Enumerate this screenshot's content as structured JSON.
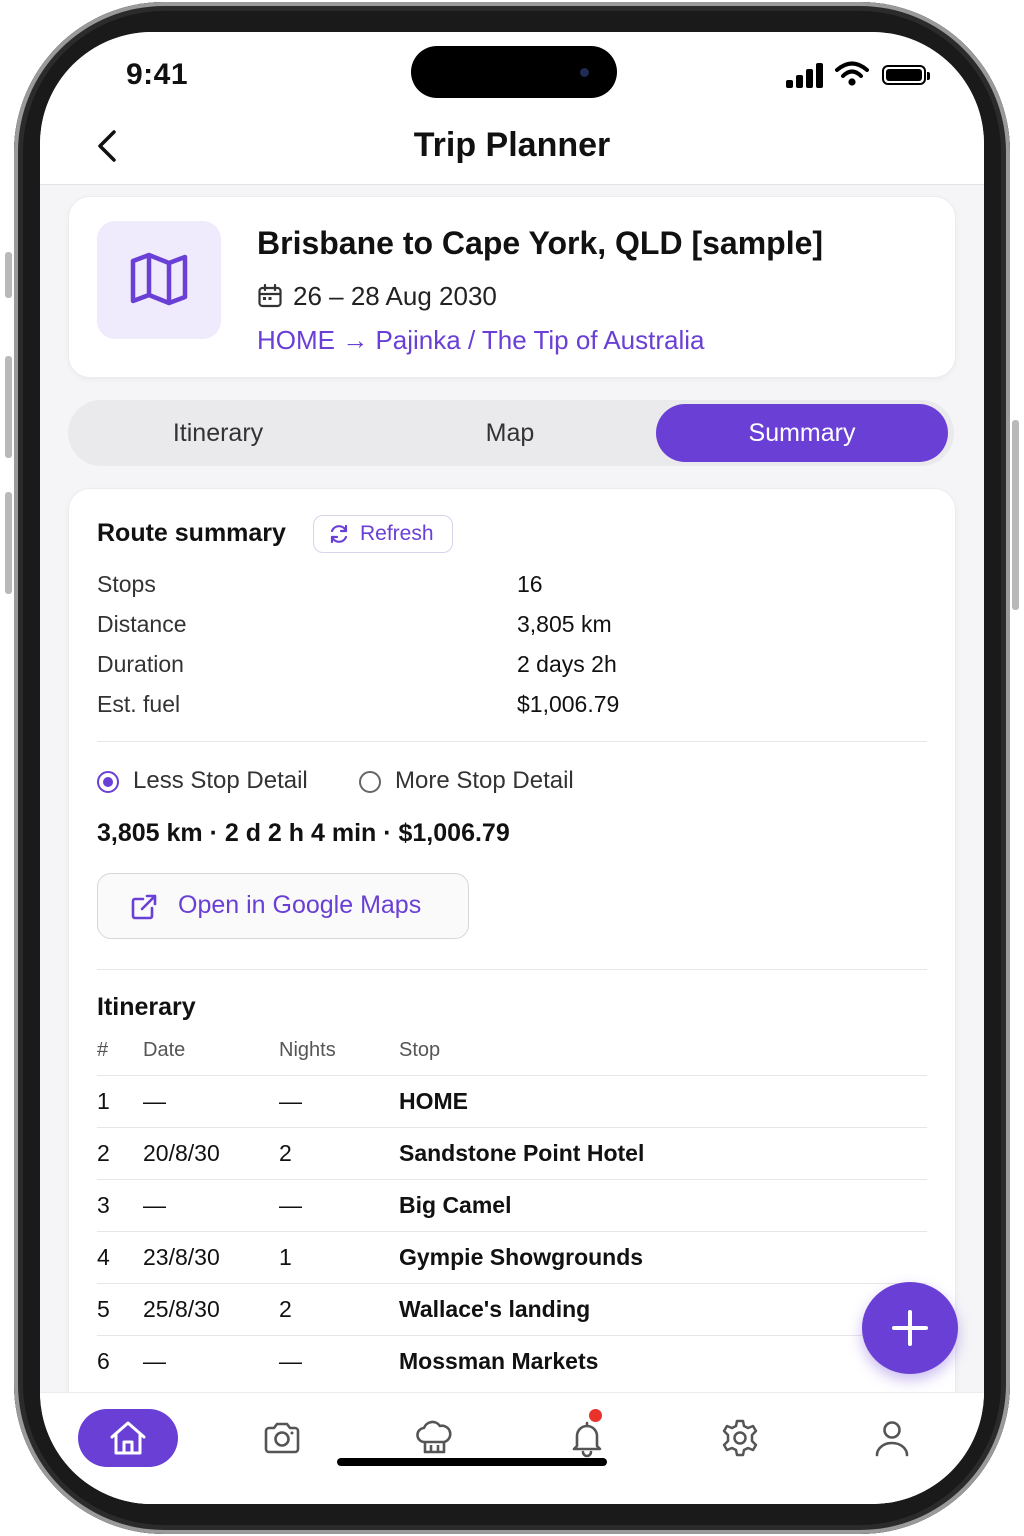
{
  "status_bar": {
    "time": "9:41"
  },
  "nav": {
    "title": "Trip Planner"
  },
  "trip": {
    "title": "Brisbane to Cape York, QLD [sample]",
    "dates": "26 – 28 Aug 2030",
    "route": "HOME → Pajinka / The Tip of Australia"
  },
  "tabs": [
    {
      "label": "Itinerary",
      "active": false
    },
    {
      "label": "Map",
      "active": false
    },
    {
      "label": "Summary",
      "active": true
    }
  ],
  "summary": {
    "title": "Route summary",
    "refresh_label": "Refresh",
    "rows": [
      {
        "label": "Stops",
        "value": "16"
      },
      {
        "label": "Distance",
        "value": "3,805 km"
      },
      {
        "label": "Duration",
        "value": "2 days 2h"
      },
      {
        "label": "Est. fuel",
        "value": "$1,006.79"
      }
    ],
    "detail_options": [
      {
        "label": "Less Stop Detail",
        "selected": true
      },
      {
        "label": "More Stop Detail",
        "selected": false
      }
    ],
    "totals": "3,805 km · 2 d 2 h 4 min · $1,006.79",
    "open_maps_label": "Open in Google Maps"
  },
  "itinerary": {
    "title": "Itinerary",
    "headers": [
      "#",
      "Date",
      "Nights",
      "Stop"
    ],
    "rows": [
      {
        "num": "1",
        "date": "—",
        "nights": "—",
        "stop": "HOME"
      },
      {
        "num": "2",
        "date": "20/8/30",
        "nights": "2",
        "stop": "Sandstone Point Hotel"
      },
      {
        "num": "3",
        "date": "—",
        "nights": "—",
        "stop": "Big Camel"
      },
      {
        "num": "4",
        "date": "23/8/30",
        "nights": "1",
        "stop": "Gympie Showgrounds"
      },
      {
        "num": "5",
        "date": "25/8/30",
        "nights": "2",
        "stop": "Wallace's landing"
      },
      {
        "num": "6",
        "date": "—",
        "nights": "—",
        "stop": "Mossman Markets"
      }
    ]
  },
  "tabbar": {
    "items": [
      "home-icon",
      "camera-icon",
      "chef-hat-icon",
      "bell-icon",
      "gear-icon",
      "user-icon"
    ],
    "active": "home-icon",
    "notification_badge": "bell-icon"
  },
  "colors": {
    "accent": "#6a3fd6",
    "badge": "#e8322a",
    "tile_bg": "#efeafc"
  }
}
